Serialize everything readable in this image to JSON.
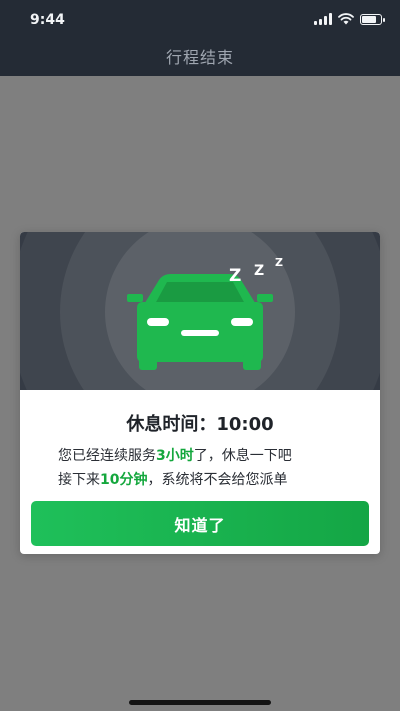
{
  "status_bar": {
    "time": "9:44",
    "battery_level": 0.85
  },
  "nav": {
    "title": "行程结束"
  },
  "modal": {
    "title": "休息时间：10:00",
    "line1": {
      "before": "您已经连续服务",
      "highlight": "3小时",
      "after": "了，休息一下吧"
    },
    "line2": {
      "before": "接下来",
      "highlight": "10分钟",
      "after": "，系统将不会给您派单"
    },
    "button_label": "知道了",
    "zzz": [
      "Z",
      "Z",
      "Z"
    ]
  },
  "colors": {
    "accent": "#14a73d",
    "topbar": "#242b35",
    "overlay": "#7f7f7f"
  },
  "icons": [
    "signal-icon",
    "wifi-icon",
    "battery-icon",
    "car-icon"
  ]
}
